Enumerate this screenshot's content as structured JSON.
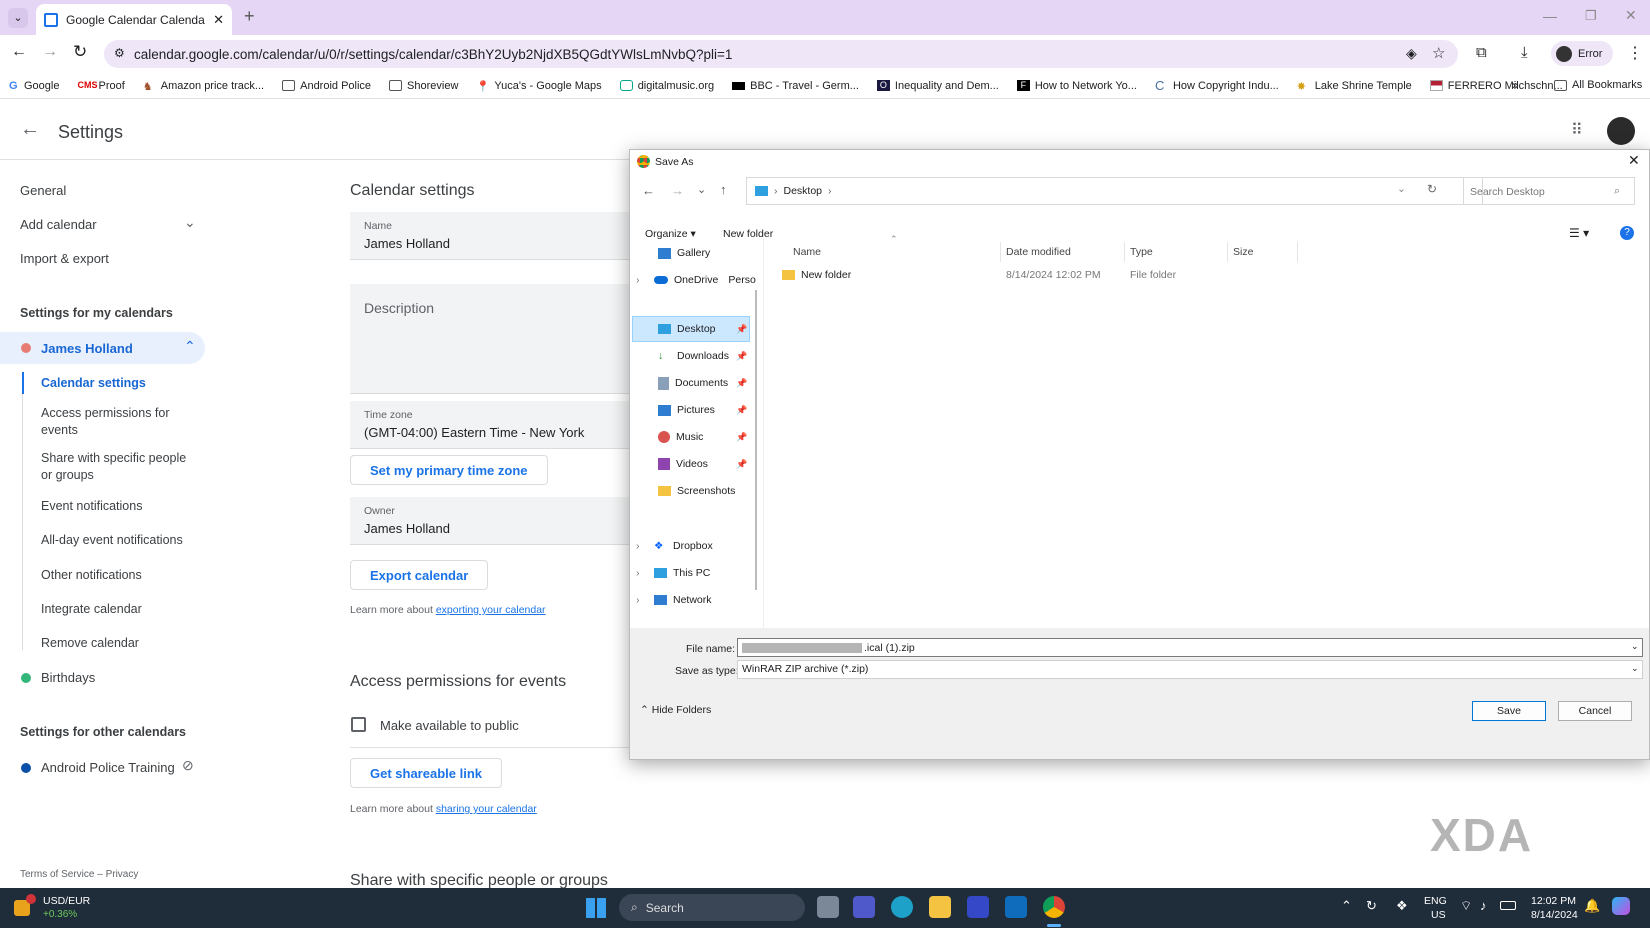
{
  "browser": {
    "tab_title": "Google Calendar  Calendar se",
    "url": "calendar.google.com/calendar/u/0/r/settings/calendar/c3BhY2Uyb2NjdXB5QGdtYWlsLmNvbQ?pli=1",
    "profile_label": "Error",
    "bookmarks": [
      "Google",
      "Proof",
      "Amazon price track...",
      "Android Police",
      "Shoreview",
      "Yuca's - Google Maps",
      "digitalmusic.org",
      "BBC - Travel - Germ...",
      "Inequality and Dem...",
      "How to Network Yo...",
      "How Copyright Indu...",
      "Lake Shrine Temple",
      "FERRERO Milchschn..."
    ],
    "all_bookmarks": "All Bookmarks"
  },
  "settings": {
    "title": "Settings",
    "nav": {
      "general": "General",
      "add_calendar": "Add calendar",
      "import_export": "Import & export",
      "my_calendars_heading": "Settings for my calendars",
      "calendar_name": "James Holland",
      "sub_items": [
        "Calendar settings",
        "Access permissions for events",
        "Share with specific people or groups",
        "Event notifications",
        "All-day event notifications",
        "Other notifications",
        "Integrate calendar",
        "Remove calendar"
      ],
      "birthdays": "Birthdays",
      "other_calendars_heading": "Settings for other calendars",
      "other_calendar": "Android Police Training",
      "footer": "Terms of Service – Privacy"
    },
    "main": {
      "section_title": "Calendar settings",
      "name_label": "Name",
      "name_value": "James Holland",
      "description_label": "Description",
      "timezone_label": "Time zone",
      "timezone_value": "(GMT-04:00) Eastern Time - New York",
      "primary_tz_button": "Set my primary time zone",
      "owner_label": "Owner",
      "owner_value": "James Holland",
      "export_button": "Export calendar",
      "export_help_prefix": "Learn more about ",
      "export_help_link": "exporting your calendar",
      "access_title": "Access permissions for events",
      "public_checkbox": "Make available to public",
      "share_link_button": "Get shareable link",
      "share_help_prefix": "Learn more about ",
      "share_help_link": "sharing your calendar",
      "share_people_title": "Share with specific people or groups"
    }
  },
  "dialog": {
    "title": "Save As",
    "breadcrumb": "Desktop",
    "search_placeholder": "Search Desktop",
    "organize": "Organize",
    "new_folder_btn": "New folder",
    "tree": [
      "Gallery",
      "OneDrive",
      "Desktop",
      "Downloads",
      "Documents",
      "Pictures",
      "Music",
      "Videos",
      "Screenshots",
      "Dropbox",
      "This PC",
      "Network"
    ],
    "onedrive_suffix": "Perso",
    "columns": {
      "name": "Name",
      "date": "Date modified",
      "type": "Type",
      "size": "Size"
    },
    "files": [
      {
        "name": "New folder",
        "date": "8/14/2024 12:02 PM",
        "type": "File folder"
      }
    ],
    "file_name_label": "File name:",
    "file_name_value": ".ical (1).zip",
    "save_type_label": "Save as type:",
    "save_type_value": "WinRAR ZIP archive (*.zip)",
    "hide_folders": "Hide Folders",
    "save": "Save",
    "cancel": "Cancel"
  },
  "taskbar": {
    "ticker": "USD/EUR",
    "ticker_change": "+0.36%",
    "search": "Search",
    "lang": "ENG",
    "region": "US",
    "time": "12:02 PM",
    "date": "8/14/2024"
  },
  "watermark": "XDA"
}
